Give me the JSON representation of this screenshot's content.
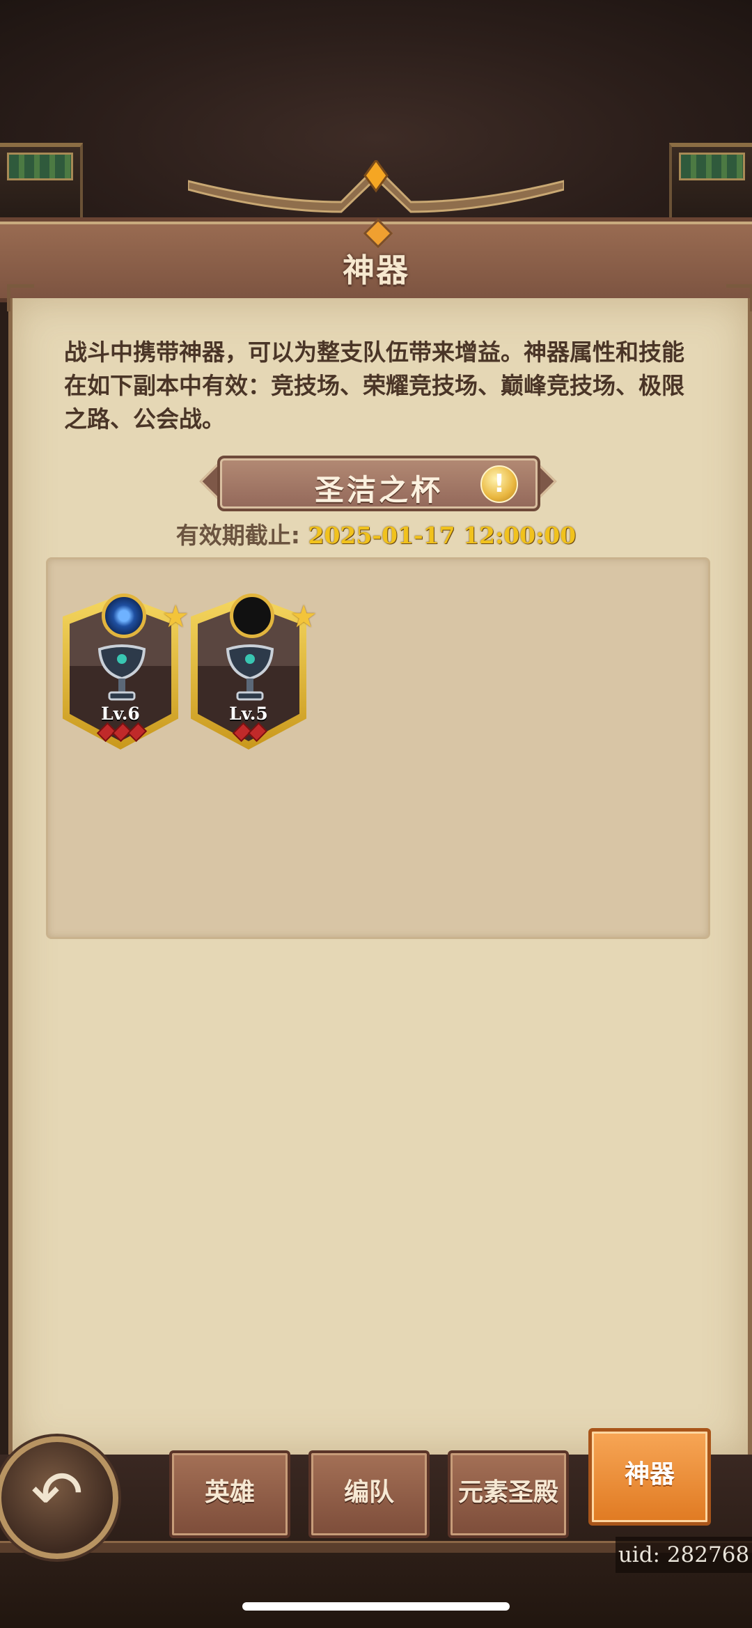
{
  "header": {
    "title": "神器"
  },
  "description": "战斗中携带神器，可以为整支队伍带来增益。神器属性和技能在如下副本中有效：竞技场、荣耀竞技场、巅峰竞技场、极限之路、公会战。",
  "artifact": {
    "name": "圣洁之杯",
    "validity_label": "有效期截止:",
    "validity_date": "2025-01-17 12:00:00"
  },
  "cards": [
    {
      "level": "Lv.6",
      "gems": 3,
      "emblem": "blue-emblem"
    },
    {
      "level": "Lv.5",
      "gems": 2,
      "emblem": "empty-emblem"
    }
  ],
  "tabs": [
    "英雄",
    "编队",
    "元素圣殿",
    "神器"
  ],
  "active_tab": "神器",
  "uid": "uid: 282768",
  "colors": {
    "accent_orange": "#e98a33",
    "gold_text": "#f1c21d",
    "parchment": "#e5d7b5"
  }
}
